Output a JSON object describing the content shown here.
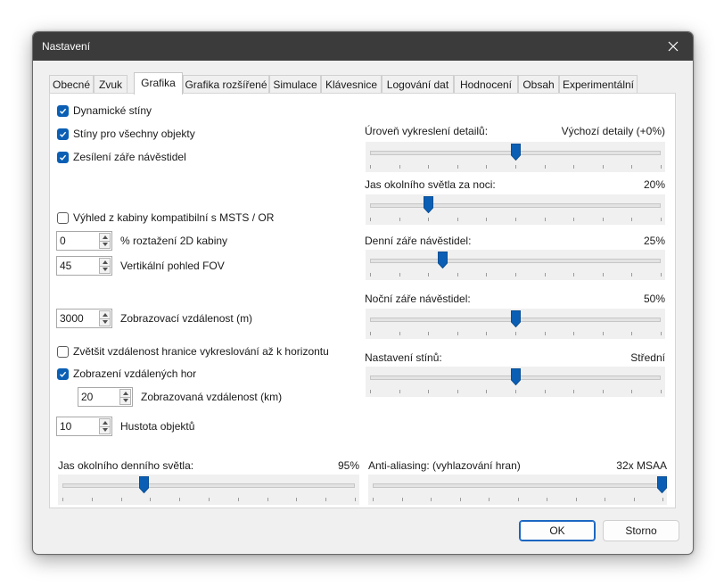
{
  "window": {
    "title": "Nastavení"
  },
  "tabs": [
    "Obecné",
    "Zvuk",
    "Grafika",
    "Grafika rozšířené",
    "Simulace",
    "Klávesnice",
    "Logování dat",
    "Hodnocení",
    "Obsah",
    "Experimentální"
  ],
  "active_tab": "Grafika",
  "checkboxes": {
    "dynamic_shadows": {
      "label": "Dynamické stíny",
      "checked": true
    },
    "shadows_all": {
      "label": "Stíny pro všechny objekty",
      "checked": true
    },
    "signal_glow": {
      "label": "Zesílení záře návěstidel",
      "checked": true
    },
    "cab_msts": {
      "label": "Výhled z kabiny kompatibilní s MSTS / OR",
      "checked": false
    },
    "extend_horizon": {
      "label": "Zvětšit vzdálenost hranice vykreslování až k horizontu",
      "checked": false
    },
    "distant_mountains": {
      "label": "Zobrazení vzdálených hor",
      "checked": true
    }
  },
  "spinners": {
    "cab_stretch": {
      "value": "0",
      "label": "% roztažení 2D kabiny"
    },
    "fov": {
      "value": "45",
      "label": "Vertikální pohled FOV"
    },
    "view_distance": {
      "value": "3000",
      "label": "Zobrazovací vzdálenost (m)"
    },
    "mountain_distance": {
      "value": "20",
      "label": "Zobrazovaná vzdálenost (km)"
    },
    "object_density": {
      "value": "10",
      "label": "Hustota objektů"
    }
  },
  "sliders": {
    "detail_level": {
      "label": "Úroveň vykreslení detailů:",
      "value_text": "Výchozí detaily (+0%)",
      "fraction": 0.5
    },
    "night_ambient": {
      "label": "Jas okolního světla za noci:",
      "value_text": "20%",
      "fraction": 0.2
    },
    "day_signal_glow": {
      "label": "Denní záře návěstidel:",
      "value_text": "25%",
      "fraction": 0.25
    },
    "night_signal_glow": {
      "label": "Noční záře návěstidel:",
      "value_text": "50%",
      "fraction": 0.5
    },
    "shadow_setting": {
      "label": "Nastavení stínů:",
      "value_text": "Střední",
      "fraction": 0.5
    },
    "day_ambient": {
      "label": "Jas okolního denního světla:",
      "value_text": "95%",
      "fraction": 0.28
    },
    "antialiasing": {
      "label": "Anti-aliasing: (vyhlazování hran)",
      "value_text": "32x MSAA",
      "fraction": 1.0
    }
  },
  "buttons": {
    "ok": "OK",
    "cancel": "Storno"
  },
  "colors": {
    "accent": "#0a5fb4",
    "titlebar": "#3b3b3b"
  }
}
